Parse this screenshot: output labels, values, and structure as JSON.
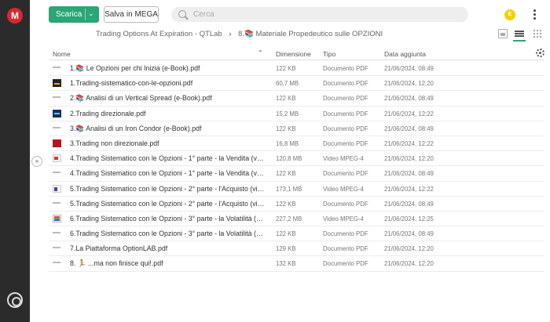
{
  "sidebar": {
    "logo_letter": "M"
  },
  "toolbar": {
    "download_label": "Scarica",
    "save_label": "Salva in MEGA",
    "search_placeholder": "Cerca",
    "avatar_initial": "E"
  },
  "breadcrumb": {
    "parent": "Trading Options At Expiration - QTLab",
    "current": "8.📚 Materiale Propedeutico sulle OPZIONI",
    "separator": "›"
  },
  "columns": {
    "name": "Nome",
    "size": "Dimensione",
    "type": "Tipo",
    "date": "Data aggiunta"
  },
  "files": [
    {
      "icon": "pdf-line",
      "name": "1.📚 Le Opzioni per chi Inizia (e-Book).pdf",
      "size": "122 KB",
      "type": "Documento PDF",
      "date": "21/06/2024, 08:49"
    },
    {
      "icon": "dark",
      "name": "1.Trading-sistematico-con-le-opzioni.pdf",
      "size": "60,7 MB",
      "type": "Documento PDF",
      "date": "21/06/2024, 12:20"
    },
    {
      "icon": "pdf-line",
      "name": "2.📚 Analisi di un Vertical Spread (e-Book).pdf",
      "size": "122 KB",
      "type": "Documento PDF",
      "date": "21/06/2024, 08:49"
    },
    {
      "icon": "blue",
      "name": "2.Trading direzionale.pdf",
      "size": "15,2 MB",
      "type": "Documento PDF",
      "date": "21/06/2024, 12:22"
    },
    {
      "icon": "pdf-line",
      "name": "3.📚 Analisi di un Iron Condor (e-Book).pdf",
      "size": "122 KB",
      "type": "Documento PDF",
      "date": "21/06/2024, 08:49"
    },
    {
      "icon": "red",
      "name": "3.Trading non direzionale.pdf",
      "size": "16,8 MB",
      "type": "Documento PDF",
      "date": "21/06/2024, 12:22"
    },
    {
      "icon": "doc",
      "name": "4.Trading Sistematico con le Opzioni - 1° parte - la Vendita (video).mp4",
      "size": "120,8 MB",
      "type": "Video MPEG-4",
      "date": "21/06/2024, 12:20"
    },
    {
      "icon": "pdf-line",
      "name": "4.Trading Sistematico con le Opzioni - 1° parte - la Vendita (video).pdf",
      "size": "122 KB",
      "type": "Documento PDF",
      "date": "21/06/2024, 08:49"
    },
    {
      "icon": "doc2",
      "name": "5.Trading Sistematico con le Opzioni - 2° parte - l'Acquisto (video).mp4",
      "size": "173,1 MB",
      "type": "Video MPEG-4",
      "date": "21/06/2024, 12:22"
    },
    {
      "icon": "pdf-line",
      "name": "5.Trading Sistematico con le Opzioni - 2° parte - l'Acquisto (video).pdf",
      "size": "122 KB",
      "type": "Documento PDF",
      "date": "21/06/2024, 08:49"
    },
    {
      "icon": "doc3",
      "name": "6.Trading Sistematico con le Opzioni - 3° parte - la Volatilità (video).mp4",
      "size": "227,2 MB",
      "type": "Video MPEG-4",
      "date": "21/06/2024, 12:25"
    },
    {
      "icon": "pdf-line",
      "name": "6.Trading Sistematico con le Opzioni - 3° parte - la Volatilità (video).pdf",
      "size": "122 KB",
      "type": "Documento PDF",
      "date": "21/06/2024, 08:49"
    },
    {
      "icon": "pdf-line",
      "name": "7.La Piattaforma OptionLAB.pdf",
      "size": "129 KB",
      "type": "Documento PDF",
      "date": "21/06/2024, 12:20"
    },
    {
      "icon": "pdf-line",
      "name": "8. 🏃 ...ma non finisce qui!.pdf",
      "size": "132 KB",
      "type": "Documento PDF",
      "date": "21/06/2024, 12:20"
    }
  ]
}
